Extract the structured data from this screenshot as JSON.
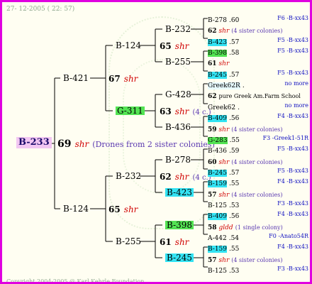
{
  "header": {
    "date": "27- 12-2005 ( 22: 57)"
  },
  "footer": {
    "copyright": "Copyright 2004-2005 @ Karl Kehrle Foundation."
  },
  "root": {
    "id": "B-233",
    "num": "69",
    "shr": "shr",
    "note": "(Drones from 2 sister colonies)"
  },
  "gen1": {
    "top": "B-421",
    "bottom": "B-124"
  },
  "gen2": {
    "a": {
      "num": "67",
      "shr": "shr"
    },
    "b": {
      "num": "65",
      "shr": "shr"
    }
  },
  "gen3": {
    "a1": "B-124",
    "a2": "G-311",
    "b1": "B-232",
    "b2": "B-255"
  },
  "gen4": {
    "a1": {
      "num": "65",
      "shr": "shr"
    },
    "a2": {
      "num": "63",
      "shr": "shr",
      "note": "(4 c.)"
    },
    "b1": {
      "num": "62",
      "shr": "shr",
      "note": "(4 c.)"
    },
    "b2": {
      "num": "61",
      "shr": "shr"
    }
  },
  "gen5": {
    "c1": "B-232",
    "c2": "B-255",
    "c3": "G-428",
    "c4": "B-436",
    "c5": "B-278",
    "c6": "B-423",
    "c7": "B-398",
    "c8": "B-245"
  },
  "rows": [
    {
      "id": "B-278",
      "val": ".60",
      "num": "",
      "shr": "",
      "note": "",
      "right": "F6 -B-xx43",
      "hl": ""
    },
    {
      "id": "",
      "val": "",
      "num": "62",
      "shr": "shr",
      "note": "(4 sister colonies)",
      "right": "",
      "hl": ""
    },
    {
      "id": "B-423",
      "val": ".57",
      "num": "",
      "shr": "",
      "note": "",
      "right": "F5 -B-xx43",
      "hl": "cyan"
    },
    {
      "id": "B-398",
      "val": ".58",
      "num": "",
      "shr": "",
      "note": "",
      "right": "F5 -B-xx43",
      "hl": "green"
    },
    {
      "id": "",
      "val": "",
      "num": "61",
      "shr": "shr",
      "note": "",
      "right": "",
      "hl": ""
    },
    {
      "id": "B-245",
      "val": ".57",
      "num": "",
      "shr": "",
      "note": "",
      "right": "F5 -B-xx43",
      "hl": "cyan"
    },
    {
      "id": "Greek62R",
      "val": ".",
      "num": "",
      "shr": "",
      "note": "",
      "right": "no more",
      "hl": "pale"
    },
    {
      "id": "",
      "val": "",
      "num": "62",
      "shr": "",
      "note": "pure Greek Am.Farm School",
      "right": "",
      "hl": ""
    },
    {
      "id": "Greek62",
      "val": ".",
      "num": "",
      "shr": "",
      "note": "",
      "right": "no more",
      "hl": ""
    },
    {
      "id": "B-409",
      "val": ".56",
      "num": "",
      "shr": "",
      "note": "",
      "right": "F4 -B-xx43",
      "hl": "cyan"
    },
    {
      "id": "",
      "val": "",
      "num": "59",
      "shr": "shr",
      "note": "(4 sister colonies)",
      "right": "",
      "hl": ""
    },
    {
      "id": "G-283",
      "val": ".55",
      "num": "",
      "shr": "",
      "note": "",
      "right": "F3 -Greek1-51R",
      "hl": "green"
    },
    {
      "id": "B-436",
      "val": ".59",
      "num": "",
      "shr": "",
      "note": "",
      "right": "F5 -B-xx43",
      "hl": ""
    },
    {
      "id": "",
      "val": "",
      "num": "60",
      "shr": "shr",
      "note": "(4 sister colonies)",
      "right": "",
      "hl": ""
    },
    {
      "id": "B-245",
      "val": ".57",
      "num": "",
      "shr": "",
      "note": "",
      "right": "F5 -B-xx43",
      "hl": "cyan"
    },
    {
      "id": "B-159",
      "val": ".55",
      "num": "",
      "shr": "",
      "note": "",
      "right": "F4 -B-xx43",
      "hl": "cyan"
    },
    {
      "id": "",
      "val": "",
      "num": "57",
      "shr": "shr",
      "note": "(4 sister colonies)",
      "right": "",
      "hl": ""
    },
    {
      "id": "B-125",
      "val": ".53",
      "num": "",
      "shr": "",
      "note": "",
      "right": "F3 -B-xx43",
      "hl": ""
    },
    {
      "id": "B-409",
      "val": ".56",
      "num": "",
      "shr": "",
      "note": "",
      "right": "F4 -B-xx43",
      "hl": "cyan"
    },
    {
      "id": "",
      "val": "",
      "num": "58",
      "shr": "gldd",
      "note": "(1 single colony)",
      "right": "",
      "hl": ""
    },
    {
      "id": "A-442",
      "val": ".54",
      "num": "",
      "shr": "",
      "note": "",
      "right": "F0 -Anato54R",
      "hl": ""
    },
    {
      "id": "B-159",
      "val": ".55",
      "num": "",
      "shr": "",
      "note": "",
      "right": "F4 -B-xx43",
      "hl": "cyan"
    },
    {
      "id": "",
      "val": "",
      "num": "57",
      "shr": "shr",
      "note": "(4 sister colonies)",
      "right": "",
      "hl": ""
    },
    {
      "id": "B-125",
      "val": ".53",
      "num": "",
      "shr": "",
      "note": "",
      "right": "F3 -B-xx43",
      "hl": ""
    }
  ]
}
